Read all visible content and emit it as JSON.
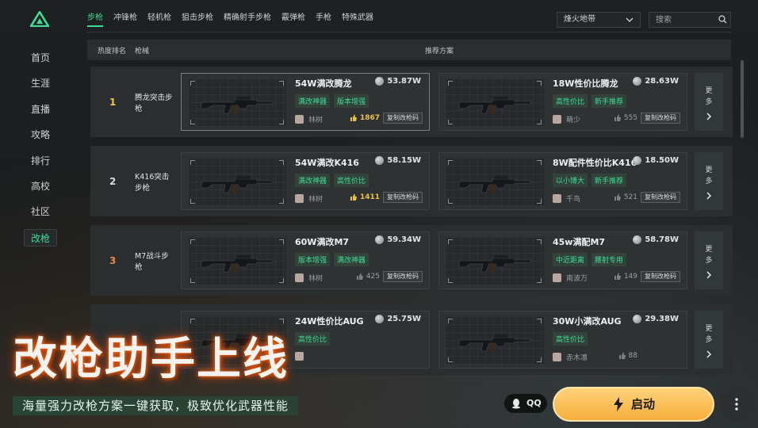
{
  "sidebar": {
    "items": [
      {
        "label": "首页",
        "active": false
      },
      {
        "label": "生涯",
        "active": false
      },
      {
        "label": "直播",
        "active": false
      },
      {
        "label": "攻略",
        "active": false
      },
      {
        "label": "排行",
        "active": false
      },
      {
        "label": "高校",
        "active": false
      },
      {
        "label": "社区",
        "active": false
      },
      {
        "label": "改枪",
        "active": true
      }
    ]
  },
  "tabs": [
    "步枪",
    "冲锋枪",
    "轻机枪",
    "狙击步枪",
    "精确射手步枪",
    "霰弹枪",
    "手枪",
    "特殊武器"
  ],
  "active_tab": "步枪",
  "map_select": {
    "value": "烽火地带"
  },
  "search": {
    "placeholder": "搜索"
  },
  "table": {
    "col_rank": "热度排名",
    "col_gun": "枪械",
    "col_plans": "推荐方案",
    "rows": [
      {
        "rank": "1",
        "rank_color": "#f2c744",
        "gun": "腾龙突击步枪",
        "plans": [
          {
            "title": "54W满改腾龙",
            "price": "53.87W",
            "tags": [
              "满改神器",
              "版本增强"
            ],
            "author": "林树",
            "likes": "1867",
            "hot": true,
            "copy": "复制改枪码",
            "selected": true
          },
          {
            "title": "18W性价比腾龙",
            "price": "28.63W",
            "tags": [
              "高性价比",
              "新手推荐"
            ],
            "author": "萌少",
            "likes": "555",
            "hot": false,
            "copy": "复制改枪码",
            "selected": false
          }
        ],
        "more": "更多"
      },
      {
        "rank": "2",
        "rank_color": "#d7dadb",
        "gun": "K416突击步枪",
        "plans": [
          {
            "title": "54W满改K416",
            "price": "58.15W",
            "tags": [
              "满改神器",
              "高性价比"
            ],
            "author": "林树",
            "likes": "1411",
            "hot": true,
            "copy": "复制改枪码",
            "selected": false
          },
          {
            "title": "8W配件性价比K416",
            "price": "18.50W",
            "tags": [
              "以小博大",
              "新手推荐"
            ],
            "author": "千鸟",
            "likes": "521",
            "hot": false,
            "copy": "复制改枪码",
            "selected": false
          }
        ],
        "more": "更多"
      },
      {
        "rank": "3",
        "rank_color": "#e8894a",
        "gun": "M7战斗步枪",
        "plans": [
          {
            "title": "60W满改M7",
            "price": "59.34W",
            "tags": [
              "版本增强",
              "满改神器"
            ],
            "author": "林树",
            "likes": "425",
            "hot": false,
            "copy": "复制改枪码",
            "selected": false
          },
          {
            "title": "45w满配M7",
            "price": "58.78W",
            "tags": [
              "中近距离",
              "腰射专用"
            ],
            "author": "南波万",
            "likes": "149",
            "hot": false,
            "copy": "复制改枪码",
            "selected": false
          }
        ],
        "more": "更多"
      },
      {
        "rank": "",
        "rank_color": "#d7dadb",
        "gun": "",
        "plans": [
          {
            "title": "24W性价比AUG",
            "price": "25.75W",
            "tags": [
              "高性价比"
            ],
            "author": "",
            "likes": "",
            "hot": false,
            "copy": "",
            "selected": false
          },
          {
            "title": "30W小满改AUG",
            "price": "29.38W",
            "tags": [
              "高性价比"
            ],
            "author": "赤木凛",
            "likes": "88",
            "hot": false,
            "copy": "",
            "selected": false
          }
        ],
        "more": "更多"
      }
    ]
  },
  "banner": {
    "title": "改枪助手上线",
    "subtitle": "海量强力改枪方案一键获取，极致优化武器性能"
  },
  "qq": {
    "label": "QQ"
  },
  "launch": {
    "label": "启动"
  },
  "colors": {
    "accent": "#3ddc97",
    "launch": "#f7ae3c"
  }
}
